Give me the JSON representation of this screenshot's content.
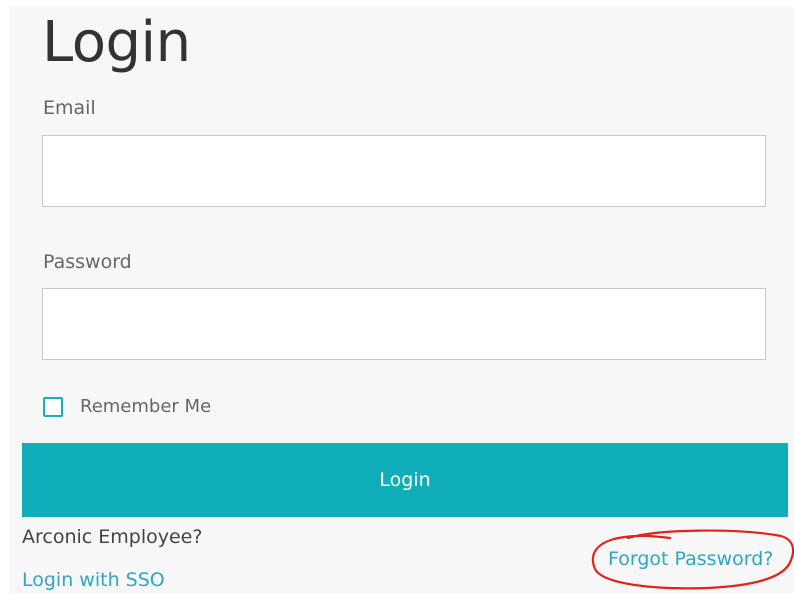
{
  "form": {
    "title": "Login",
    "email": {
      "label": "Email",
      "value": "",
      "placeholder": ""
    },
    "password": {
      "label": "Password",
      "value": "",
      "placeholder": ""
    },
    "remember_me": {
      "label": "Remember Me",
      "checked": false
    },
    "submit_label": "Login"
  },
  "footer": {
    "employee_prompt": "Arconic Employee?",
    "sso_link": "Login with SSO",
    "forgot_link": "Forgot Password?"
  },
  "colors": {
    "accent": "#0eadb8",
    "link": "#2fa6c4",
    "annotation": "#e0241c"
  }
}
